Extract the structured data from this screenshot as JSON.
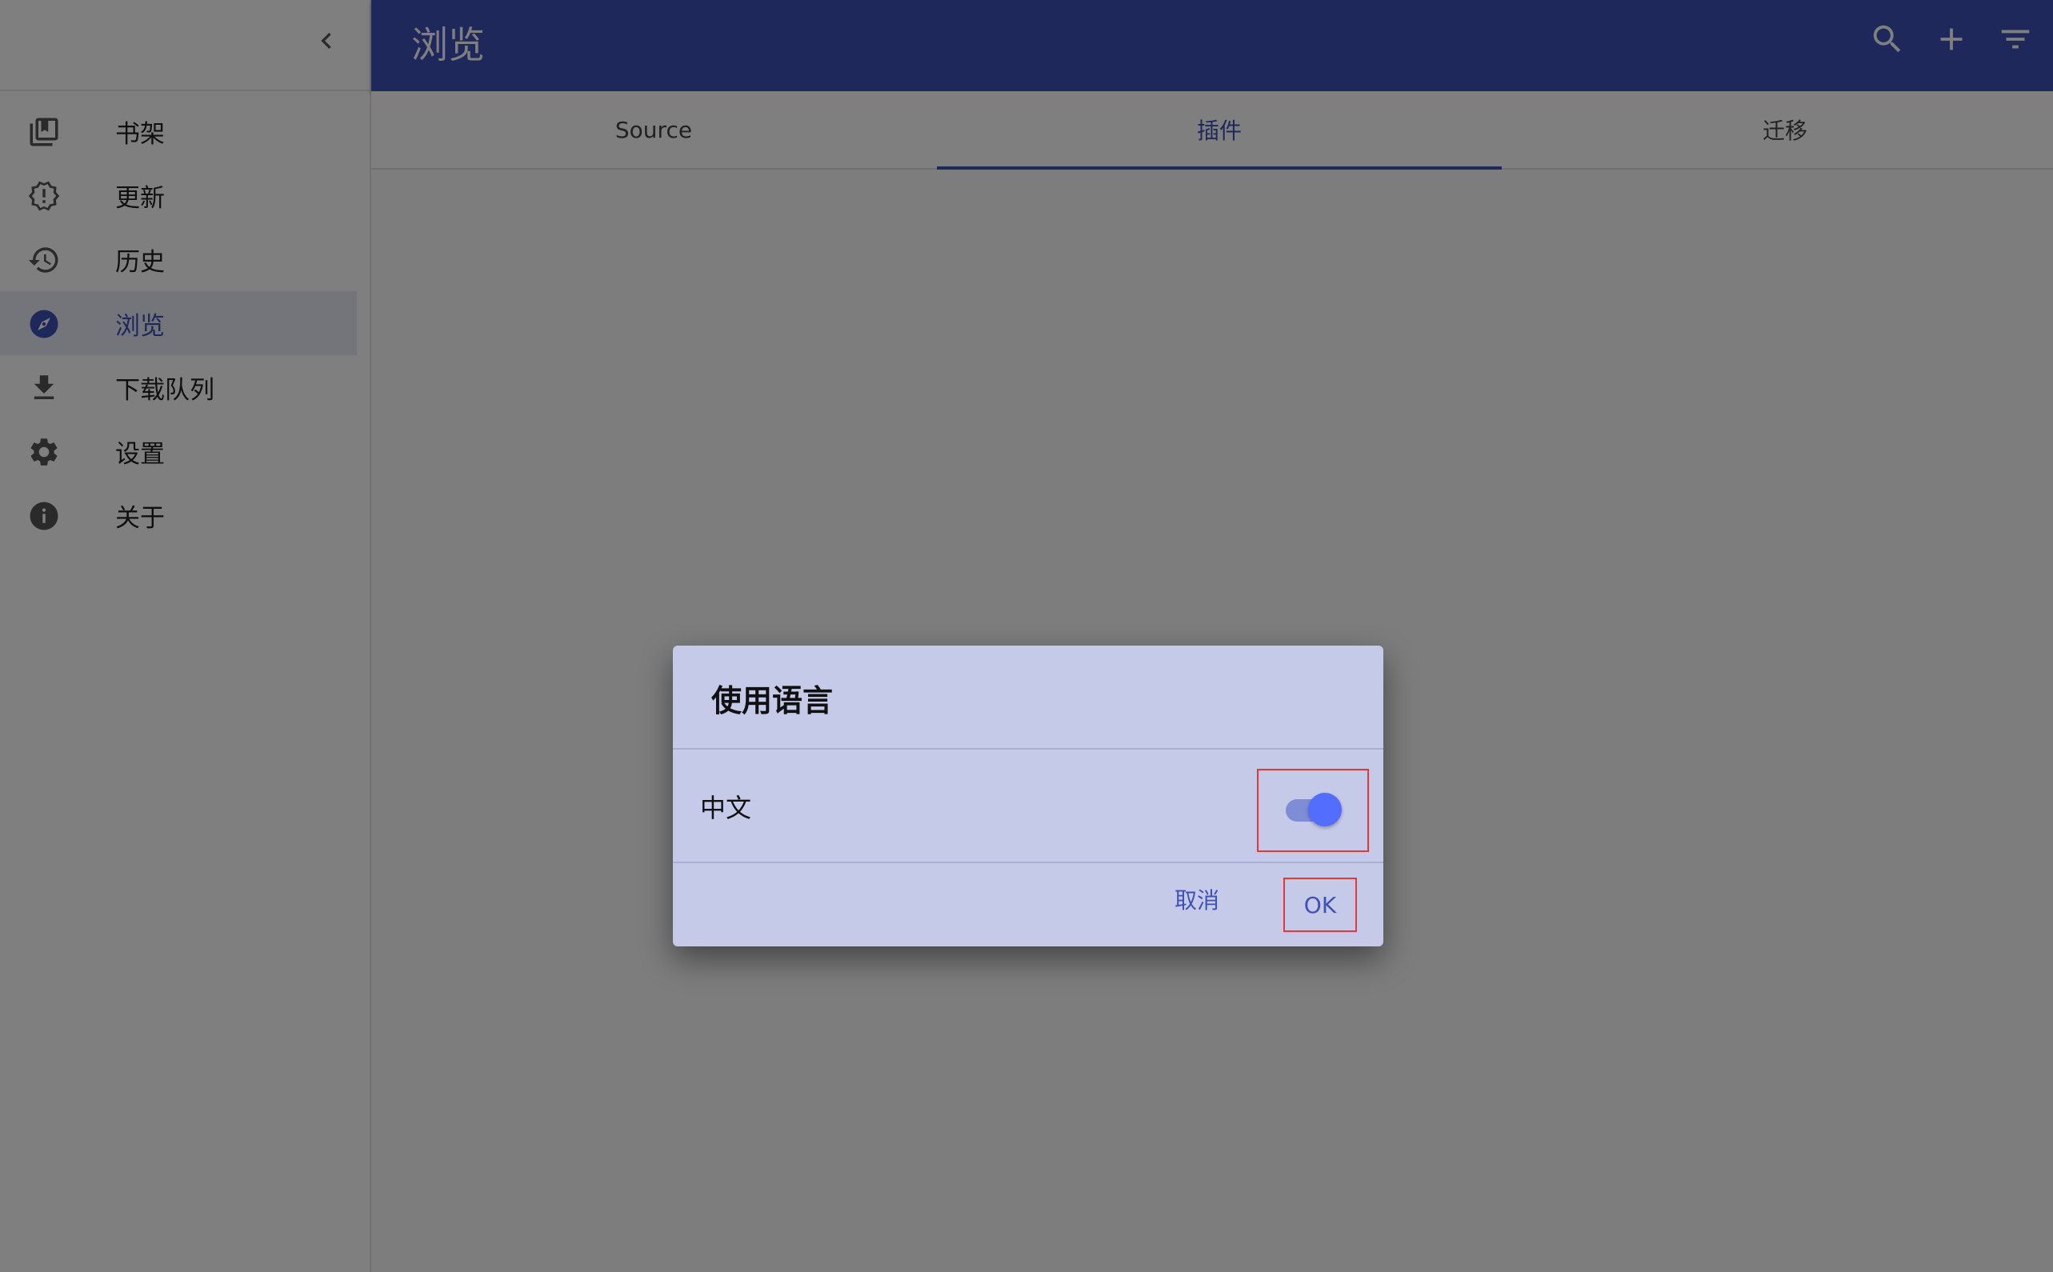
{
  "sidebar": {
    "items": [
      {
        "label": "书架",
        "icon": "library-icon",
        "active": false
      },
      {
        "label": "更新",
        "icon": "update-alert-icon",
        "active": false
      },
      {
        "label": "历史",
        "icon": "history-icon",
        "active": false
      },
      {
        "label": "浏览",
        "icon": "compass-icon",
        "active": true
      },
      {
        "label": "下载队列",
        "icon": "download-icon",
        "active": false
      },
      {
        "label": "设置",
        "icon": "gear-icon",
        "active": false
      },
      {
        "label": "关于",
        "icon": "info-icon",
        "active": false
      }
    ]
  },
  "appbar": {
    "title": "浏览",
    "actions": [
      "search-icon",
      "add-icon",
      "filter-icon"
    ]
  },
  "tabs": [
    {
      "label": "Source",
      "active": false
    },
    {
      "label": "插件",
      "active": true
    },
    {
      "label": "迁移",
      "active": false
    }
  ],
  "dialog": {
    "title": "使用语言",
    "language_label": "中文",
    "toggle_on": true,
    "cancel_label": "取消",
    "ok_label": "OK"
  },
  "colors": {
    "primary": "#3f51b5",
    "dialog_bg": "#c5cae9",
    "toggle_thumb": "#536dfe",
    "highlight_box": "#e53935"
  }
}
